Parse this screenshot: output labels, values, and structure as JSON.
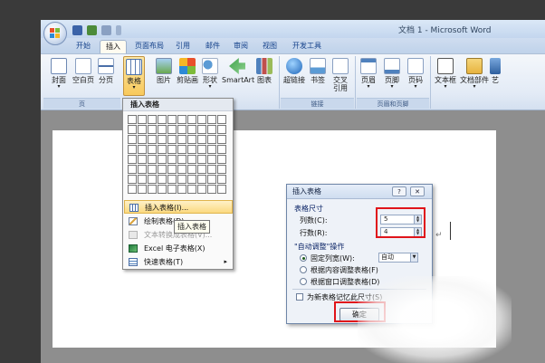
{
  "window": {
    "title": "文档 1 - Microsoft Word"
  },
  "tabs": [
    "开始",
    "插入",
    "页面布局",
    "引用",
    "邮件",
    "审阅",
    "视图",
    "开发工具"
  ],
  "active_tab": "插入",
  "ribbon": {
    "buttons": [
      {
        "label": "封面",
        "arrow": "▾",
        "icon": "cover-page-icon"
      },
      {
        "label": "空白页",
        "icon": "blank-page-icon"
      },
      {
        "label": "分页",
        "icon": "page-break-icon"
      },
      {
        "label": "表格",
        "arrow": "▾",
        "icon": "table-icon"
      },
      {
        "label": "图片",
        "icon": "picture-icon"
      },
      {
        "label": "剪贴画",
        "icon": "clip-art-icon"
      },
      {
        "label": "形状",
        "arrow": "▾",
        "icon": "shapes-icon"
      },
      {
        "label": "SmartArt",
        "icon": "smartart-icon"
      },
      {
        "label": "图表",
        "icon": "chart-icon"
      },
      {
        "label": "超链接",
        "icon": "hyperlink-icon"
      },
      {
        "label": "书签",
        "icon": "bookmark-icon"
      },
      {
        "label": "交叉\n引用",
        "icon": "cross-reference-icon"
      },
      {
        "label": "页眉",
        "arrow": "▾",
        "icon": "header-icon"
      },
      {
        "label": "页脚",
        "arrow": "▾",
        "icon": "footer-icon"
      },
      {
        "label": "页码",
        "arrow": "▾",
        "icon": "page-number-icon"
      },
      {
        "label": "文本框",
        "arrow": "▾",
        "icon": "text-box-icon"
      },
      {
        "label": "文档部件",
        "arrow": "▾",
        "icon": "quick-parts-icon"
      },
      {
        "label": "艺",
        "icon": "wordart-icon"
      }
    ],
    "groups": [
      "页",
      "链接",
      "页眉和页脚"
    ]
  },
  "table_dropdown": {
    "header": "插入表格",
    "items": [
      {
        "label": "插入表格(I)...",
        "icon": "insert-table-icon"
      },
      {
        "label": "绘制表格(D)",
        "icon": "draw-table-icon"
      },
      {
        "label": "文本转换成表格(V)...",
        "icon": "text-to-table-icon"
      },
      {
        "label": "Excel 电子表格(X)",
        "icon": "excel-icon"
      },
      {
        "label": "快速表格(T)",
        "icon": "quick-tables-icon",
        "submenu": "▸"
      }
    ],
    "tooltip": "插入表格"
  },
  "dialog": {
    "title": "插入表格",
    "help": "?",
    "close": "✕",
    "table_size": {
      "label": "表格尺寸",
      "columns_label": "列数(C):",
      "columns_value": "5",
      "rows_label": "行数(R):",
      "rows_value": "4"
    },
    "autofit": {
      "label": "\"自动调整\"操作",
      "options": [
        {
          "label": "固定列宽(W):",
          "selected": true
        },
        {
          "label": "根据内容调整表格(F)",
          "selected": false
        },
        {
          "label": "根据窗口调整表格(D)",
          "selected": false
        }
      ],
      "width_value": "自动"
    },
    "remember_label": "为新表格记忆此尺寸(S)",
    "ok_label": "确定"
  },
  "colors": {
    "highlight_box": "#e0141a",
    "ribbon_selected": "#f8c95c"
  }
}
